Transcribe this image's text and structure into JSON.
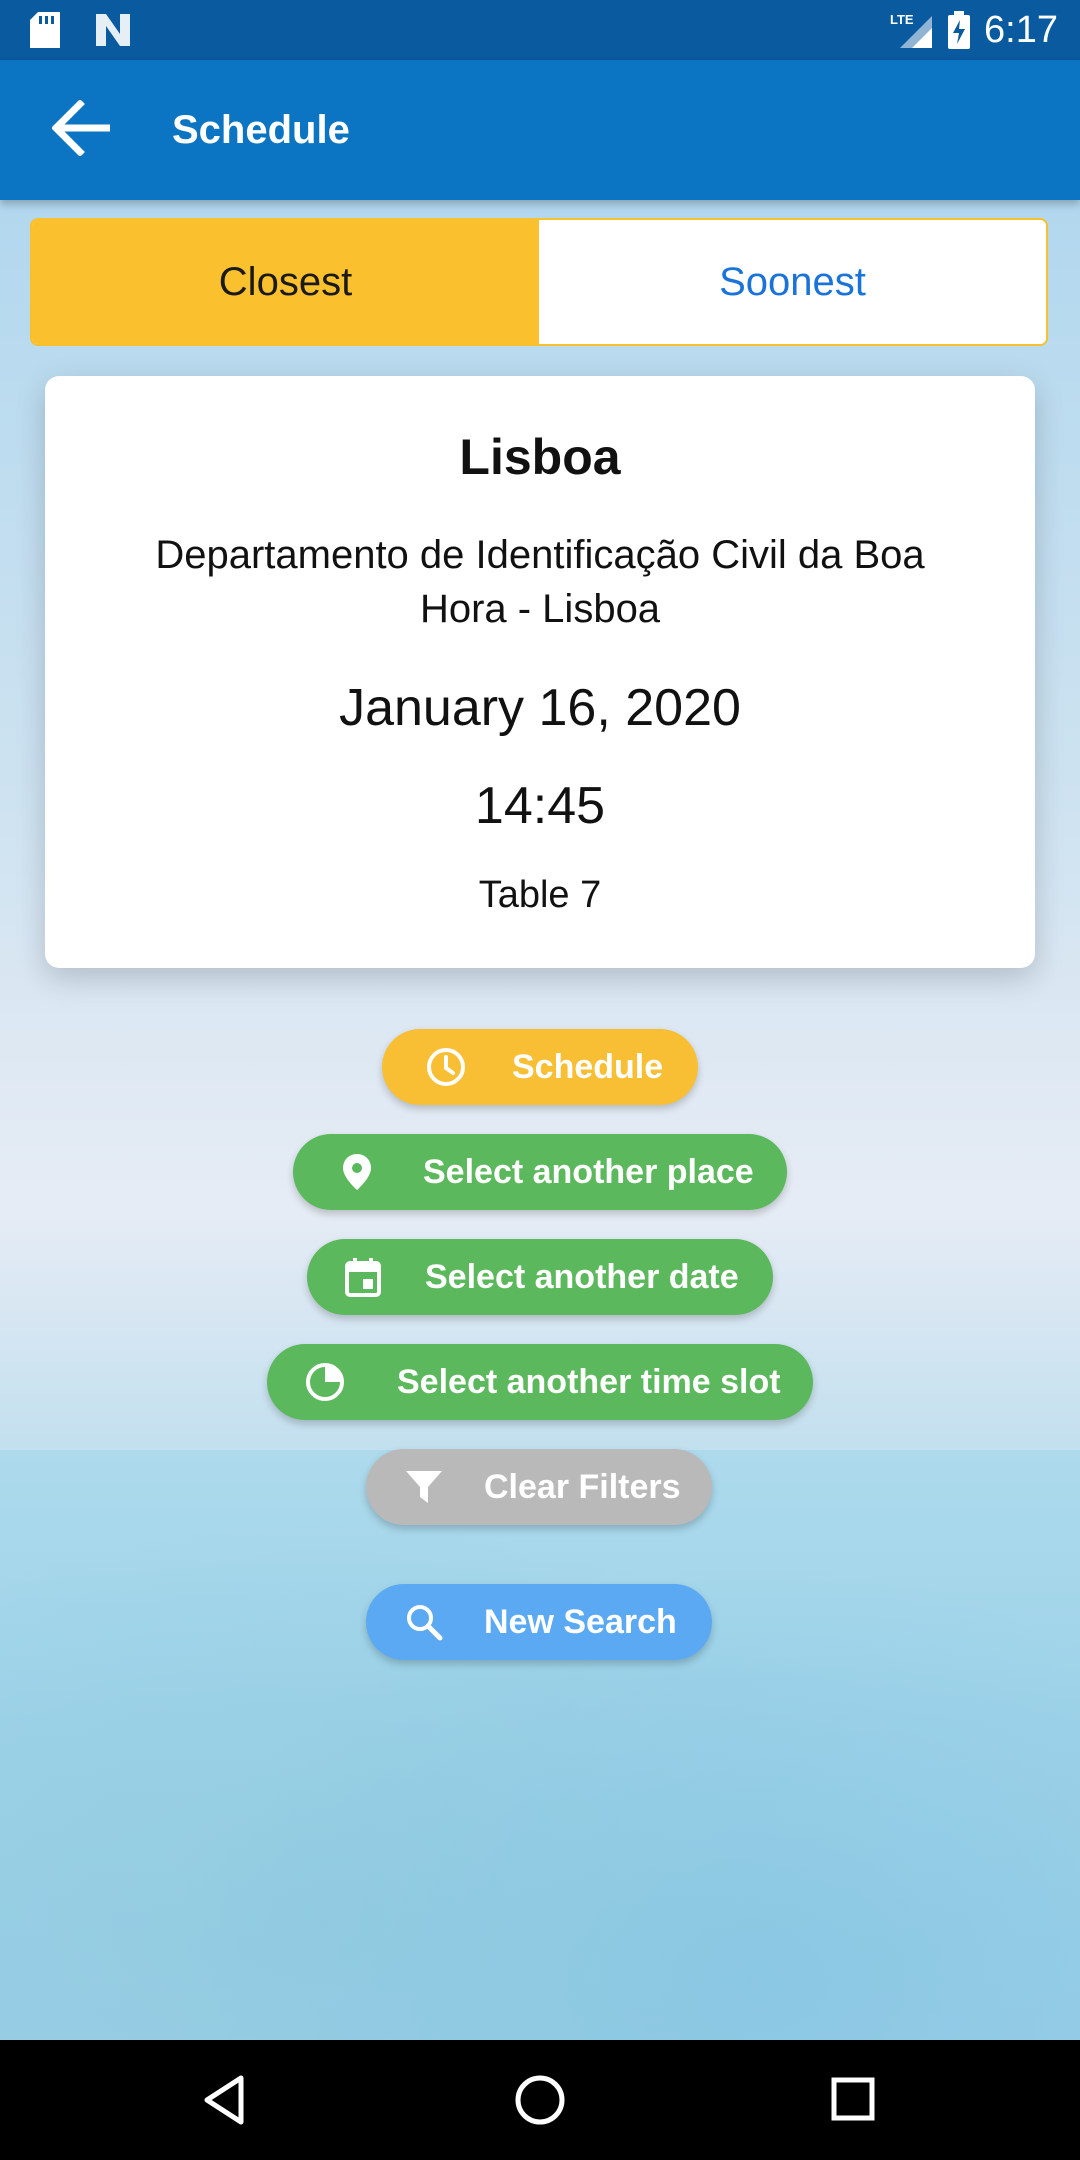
{
  "status_bar": {
    "time": "6:17",
    "network": "LTE",
    "icons": [
      "sd-card-icon",
      "n-notification-icon",
      "lte-signal-icon",
      "battery-charging-icon"
    ]
  },
  "app_bar": {
    "title": "Schedule",
    "back_icon": "arrow-back-icon"
  },
  "tabs": [
    {
      "label": "Closest",
      "active": true
    },
    {
      "label": "Soonest",
      "active": false
    }
  ],
  "result": {
    "city": "Lisboa",
    "department": "Departamento de Identificação Civil da Boa Hora - Lisboa",
    "date": "January 16, 2020",
    "time": "14:45",
    "table": "Table 7"
  },
  "actions": {
    "schedule": {
      "label": "Schedule",
      "icon": "clock-icon",
      "color": "#f9bf34"
    },
    "place": {
      "label": "Select another place",
      "icon": "location-pin-icon",
      "color": "#5cb85c"
    },
    "date": {
      "label": "Select another date",
      "icon": "calendar-icon",
      "color": "#5cb85c"
    },
    "timeslot": {
      "label": "Select another time slot",
      "icon": "time-slot-icon",
      "color": "#5cb85c"
    },
    "clear": {
      "label": "Clear Filters",
      "icon": "filter-icon",
      "color": "#b9b9b9"
    },
    "search": {
      "label": "New Search",
      "icon": "search-icon",
      "color": "#5aa9f2"
    }
  },
  "colors": {
    "status_bar": "#0a5aa0",
    "app_bar": "#0b74c3",
    "active_tab": "#fbc02d",
    "inactive_tab_text": "#1a73d9"
  },
  "nav_bar": {
    "icons": [
      "back-triangle-icon",
      "home-circle-icon",
      "recents-square-icon"
    ]
  }
}
